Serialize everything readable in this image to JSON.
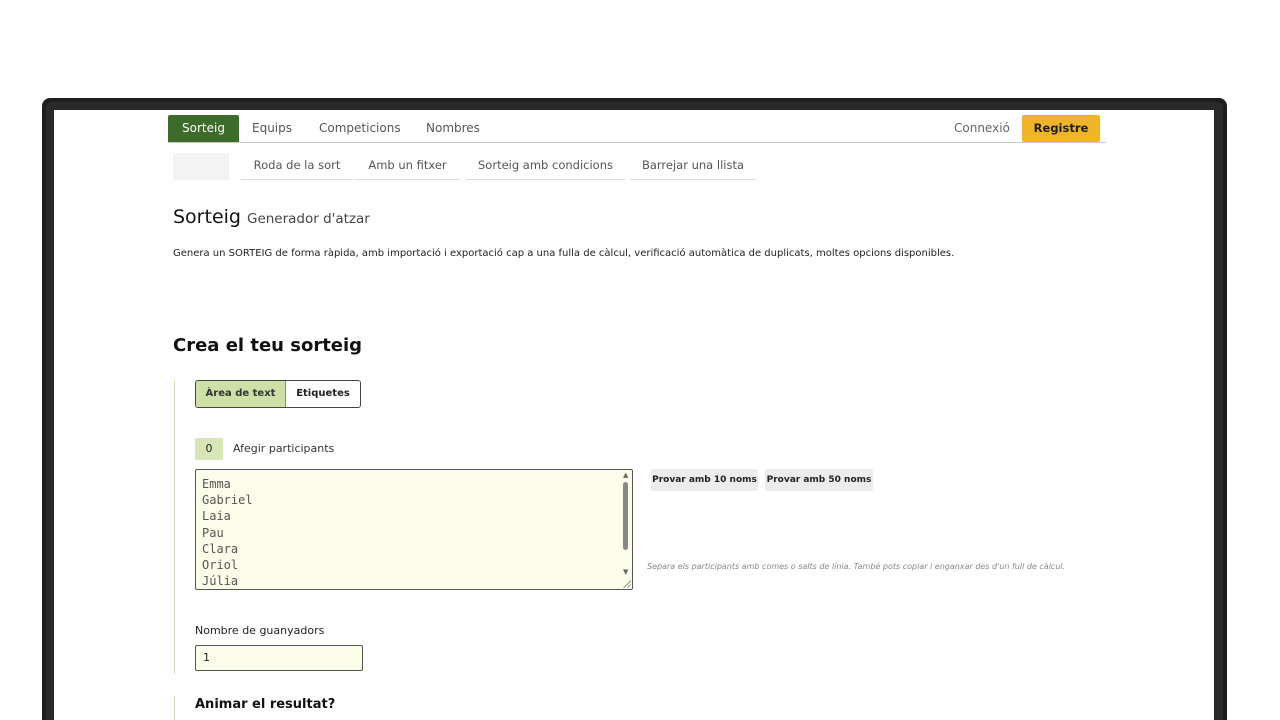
{
  "topnav": {
    "tabs": [
      "Sorteig",
      "Equips",
      "Competicions",
      "Nombres"
    ],
    "login": "Connexió",
    "register": "Registre"
  },
  "subnav": {
    "items": [
      "Roda de la sort",
      "Amb un fitxer",
      "Sorteig amb condicions",
      "Barrejar una llista"
    ]
  },
  "header": {
    "title": "Sorteig",
    "subtitle": "Generador d'atzar",
    "description": "Genera un SORTEIG de forma ràpida, amb importació i exportació cap a una fulla de càlcul, verificació automàtica de duplicats, moltes opcions disponibles."
  },
  "form": {
    "section_title": "Crea el teu sorteig",
    "mode_toggle": [
      "Àrea de text",
      "Etiquetes"
    ],
    "participant_count": "0",
    "add_participants_label": "Afegir participants",
    "participants_text": "Emma\nGabriel\nLaia\nPau\nClara\nOriol\nJúlia",
    "try_10": "Provar amb 10 noms",
    "try_50": "Provar amb 50 noms",
    "hint": "Separa els participants amb comes o salts de línia. També pots copiar i enganxar des d'un full de càlcul.",
    "winners_label": "Nombre de guanyadors",
    "winners_value": "1",
    "animate_label": "Animar el resultat?"
  },
  "colors": {
    "nav_active": "#3d6b2a",
    "register": "#f0b429",
    "accent_light": "#cfe0a6",
    "input_bg": "#fcfde9"
  }
}
